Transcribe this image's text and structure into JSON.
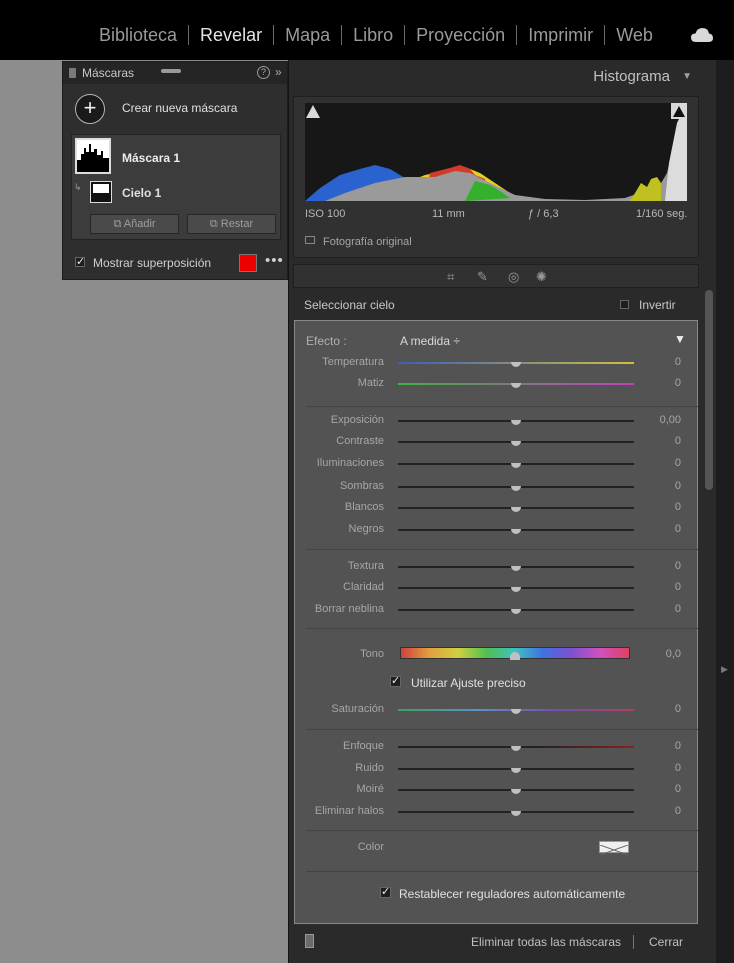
{
  "nav": {
    "items": [
      "Biblioteca",
      "Revelar",
      "Mapa",
      "Libro",
      "Proyección",
      "Imprimir",
      "Web"
    ],
    "active": "Revelar",
    "cloud_icon": "cloud-icon"
  },
  "mask_panel": {
    "title": "Máscaras",
    "create_label": "Crear nueva máscara",
    "mask_name": "Máscara 1",
    "sub_mask_name": "Cielo 1",
    "add_label": "Añadir",
    "subtract_label": "Restar",
    "overlay_label": "Mostrar superposición",
    "overlay_checked": true,
    "overlay_color": "#ee0000"
  },
  "histogram": {
    "title": "Histograma",
    "iso": "ISO 100",
    "focal": "11 mm",
    "aperture": "ƒ / 6,3",
    "shutter": "1/160 seg.",
    "original_label": "Fotografía original"
  },
  "sky": {
    "select_label": "Seleccionar cielo",
    "invert_label": "Invertir"
  },
  "effect": {
    "label": "Efecto :",
    "value": "A medida ÷"
  },
  "sliders": {
    "temperatura": {
      "label": "Temperatura",
      "value": "0"
    },
    "matiz": {
      "label": "Matiz",
      "value": "0"
    },
    "exposicion": {
      "label": "Exposición",
      "value": "0,00"
    },
    "contraste": {
      "label": "Contraste",
      "value": "0"
    },
    "iluminaciones": {
      "label": "Iluminaciones",
      "value": "0"
    },
    "sombras": {
      "label": "Sombras",
      "value": "0"
    },
    "blancos": {
      "label": "Blancos",
      "value": "0"
    },
    "negros": {
      "label": "Negros",
      "value": "0"
    },
    "textura": {
      "label": "Textura",
      "value": "0"
    },
    "claridad": {
      "label": "Claridad",
      "value": "0"
    },
    "neblina": {
      "label": "Borrar neblina",
      "value": "0"
    },
    "tono": {
      "label": "Tono",
      "value": "0,0"
    },
    "saturacion": {
      "label": "Saturación",
      "value": "0"
    },
    "enfoque": {
      "label": "Enfoque",
      "value": "0"
    },
    "ruido": {
      "label": "Ruido",
      "value": "0"
    },
    "moire": {
      "label": "Moiré",
      "value": "0"
    },
    "halos": {
      "label": "Eliminar halos",
      "value": "0"
    }
  },
  "fine_adjust_label": "Utilizar Ajuste preciso",
  "color_label": "Color",
  "reset_label": "Restablecer reguladores automáticamente",
  "footer": {
    "delete_all": "Eliminar todas las máscaras",
    "close": "Cerrar"
  }
}
